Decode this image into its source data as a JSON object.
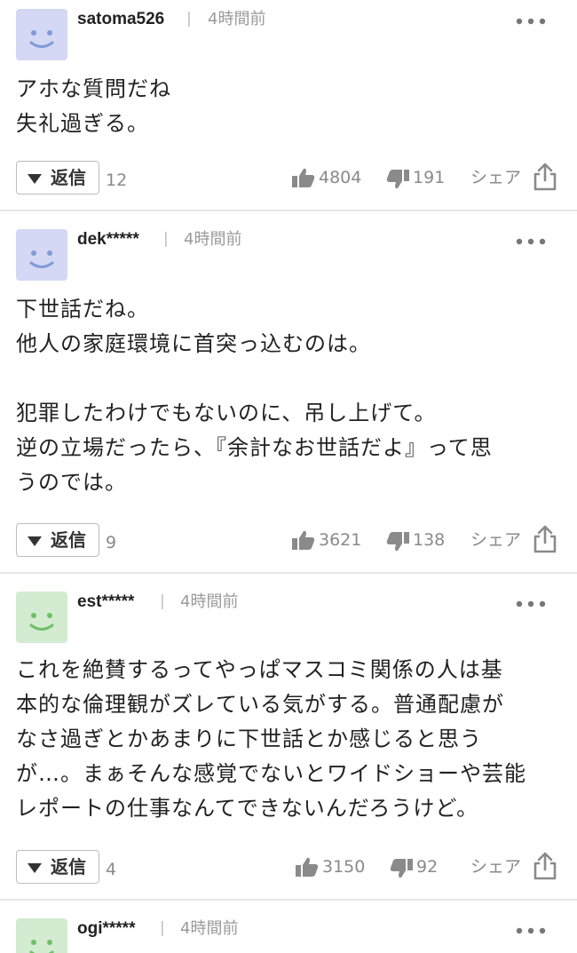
{
  "colors": {
    "avatar_blue": "#d5d8f4",
    "avatar_green": "#d3ecd1",
    "face_blue": "#7f9bd8",
    "face_green": "#6fbf6a",
    "meta_gray": "#8a8a8a"
  },
  "icons": {
    "more": "more-dots-icon",
    "thumb_up": "thumbs-up-icon",
    "thumb_down": "thumbs-down-icon",
    "share": "share-icon",
    "reply_toggle": "triangle-down-icon"
  },
  "comments": [
    {
      "username": "satoma526",
      "separator": "|",
      "time": "4時間前",
      "avatar_color": "blue",
      "body": "アホな質問だね\n失礼過ぎる。",
      "reply_label": "返信",
      "reply_count": "12",
      "likes": "4804",
      "dislikes": "191",
      "share_label": "シェア"
    },
    {
      "username": "dek*****",
      "separator": "|",
      "time": "4時間前",
      "avatar_color": "blue",
      "body": "下世話だね。\n他人の家庭環境に首突っ込むのは。\n\n犯罪したわけでもないのに、吊し上げて。\n逆の立場だったら、『余計なお世話だよ』って思\nうのでは。",
      "reply_label": "返信",
      "reply_count": "9",
      "likes": "3621",
      "dislikes": "138",
      "share_label": "シェア"
    },
    {
      "username": "est*****",
      "separator": "|",
      "time": "4時間前",
      "avatar_color": "green",
      "body": "これを絶賛するってやっぱマスコミ関係の人は基\n本的な倫理観がズレている気がする。普通配慮が\nなさ過ぎとかあまりに下世話とか感じると思う\nが…。まぁそんな感覚でないとワイドショーや芸能\nレポートの仕事なんてできないんだろうけど。",
      "reply_label": "返信",
      "reply_count": "4",
      "likes": "3150",
      "dislikes": "92",
      "share_label": "シェア"
    },
    {
      "username": "ogi*****",
      "separator": "|",
      "time": "4時間前",
      "avatar_color": "green"
    }
  ]
}
